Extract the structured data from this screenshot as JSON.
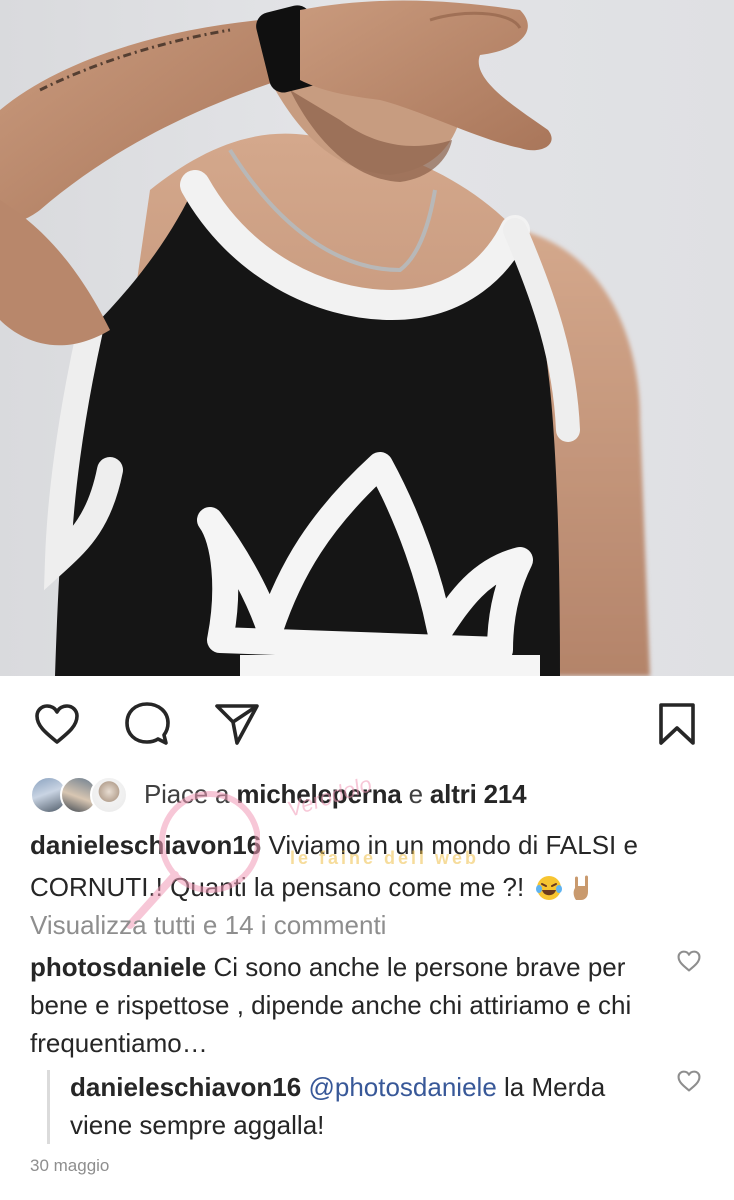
{
  "post": {
    "image_alt": "Uomo con canotta nera da basket con bordo bianco e simbolo a corona, braccio teso verso la fotocamera"
  },
  "actions": {
    "like_icon": "heart-icon",
    "comment_icon": "comment-icon",
    "share_icon": "paper-plane-icon",
    "save_icon": "bookmark-icon"
  },
  "likes": {
    "prefix": "Piace a ",
    "user": "micheleperna",
    "connector": " e ",
    "others": "altri 214"
  },
  "caption": {
    "username": "danieleschiavon16",
    "text": " Viviamo in un mondo di FALSI e CORNUTI.! Quanti la pensano come me ?! ",
    "emojis": [
      "laughing-tears-emoji",
      "rock-hand-emoji"
    ]
  },
  "view_all_comments": "Visualizza tutti e 14 i commenti",
  "comments": [
    {
      "username": "photosdaniele",
      "text": " Ci sono anche le persone brave per bene e rispettose , dipende anche chi attiriamo e chi frequentiamo…"
    },
    {
      "username": "danieleschiavon16",
      "mention": "@photosdaniele",
      "text": " la Merda viene sempre aggalla!"
    }
  ],
  "date": "30 maggio",
  "watermark": {
    "line1": "Verodolo",
    "line2": "le faine dell web"
  },
  "colors": {
    "text": "#262626",
    "secondary": "#8e8e8e",
    "mention": "#385898",
    "background": "#ffffff"
  }
}
